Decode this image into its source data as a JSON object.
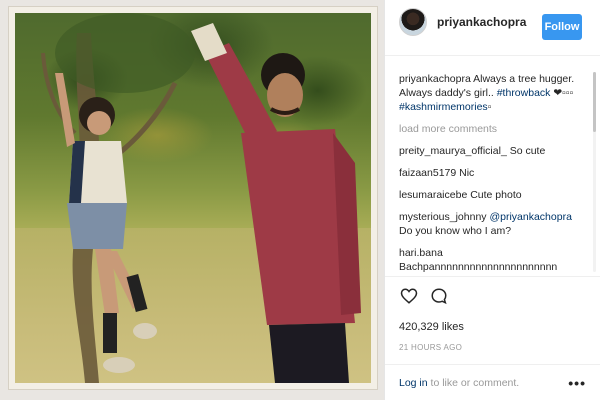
{
  "post": {
    "photo": {
      "alt_icon": "photo"
    },
    "header": {
      "username": "priyankachopra",
      "follow_label": "Follow",
      "accent_color": "#3897f0"
    },
    "caption": {
      "author": "priyankachopra",
      "text": " Always a tree hugger. Always daddy's girl.. ",
      "hashtag_1": "#throwback",
      "emoji": " ❤▫▫▫ ",
      "hashtag_2": "#kashmirmemories",
      "trailing": "▫"
    },
    "load_more": "load more comments",
    "comments": [
      {
        "author": "preity_maurya_official_",
        "text": " So cute"
      },
      {
        "author": "faizaan5179",
        "text": " Nic"
      },
      {
        "author": "lesumaraicebe",
        "text": " Cute photo"
      },
      {
        "author": "mysterious_johnny",
        "mention": " @priyankachopra",
        "text": " Do you know who I am?"
      },
      {
        "author": "hari.bana",
        "text": " Bachpannnnnnnnnnnnnnnnnnnnn"
      }
    ],
    "likes": "420,329 likes",
    "timestamp": "21 HOURS AGO",
    "footer": {
      "login_link": "Log in",
      "login_rest": " to like or comment.",
      "more_label": "•••"
    },
    "icons": {
      "like": "heart-icon",
      "comment": "comment-icon",
      "more": "more-options-icon"
    }
  }
}
